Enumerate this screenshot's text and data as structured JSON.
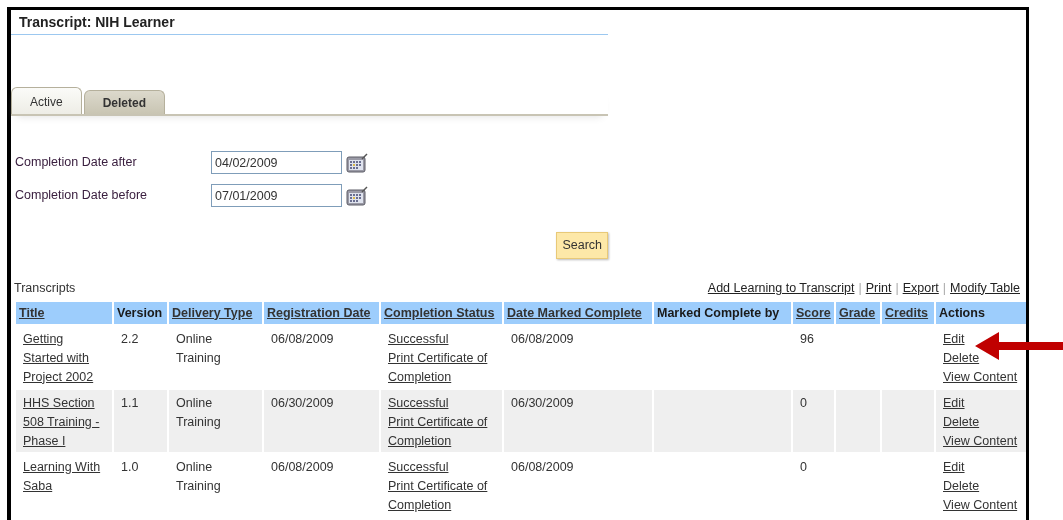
{
  "page": {
    "title": "Transcript: NIH Learner"
  },
  "tabs": [
    {
      "label": "Active",
      "selected": true
    },
    {
      "label": "Deleted",
      "selected": false
    }
  ],
  "filters": [
    {
      "label": "Completion Date after",
      "value": "04/02/2009"
    },
    {
      "label": "Completion Date before",
      "value": "07/01/2009"
    }
  ],
  "search_button": "Search",
  "transcripts": {
    "heading": "Transcripts",
    "toolbar": [
      {
        "kind": "link",
        "text": "Add Learning to Transcript"
      },
      {
        "kind": "separator",
        "text": "|"
      },
      {
        "kind": "link",
        "text": "Print"
      },
      {
        "kind": "separator",
        "text": "|"
      },
      {
        "kind": "link",
        "text": "Export"
      },
      {
        "kind": "separator",
        "text": "|"
      },
      {
        "kind": "link",
        "text": "Modify Table"
      }
    ],
    "columns": [
      {
        "label": "Title",
        "sortable": true
      },
      {
        "label": "Version",
        "sortable": false
      },
      {
        "label": "Delivery Type",
        "sortable": true
      },
      {
        "label": "Registration Date",
        "sortable": true
      },
      {
        "label": "Completion Status",
        "sortable": true
      },
      {
        "label": "Date Marked Complete",
        "sortable": true
      },
      {
        "label": "Marked Complete by",
        "sortable": false
      },
      {
        "label": "Score",
        "sortable": true
      },
      {
        "label": "Grade",
        "sortable": true
      },
      {
        "label": "Credits",
        "sortable": true
      },
      {
        "label": "Actions",
        "sortable": false
      }
    ],
    "rows": [
      {
        "title": "Getting Started with Project 2002",
        "version": "2.2",
        "delivery_type": "Online Training",
        "registration_date": "06/08/2009",
        "completion_status": "Successful",
        "certificate_link": "Print Certificate of Completion",
        "date_marked_complete": "06/08/2009",
        "score": "96",
        "actions": [
          "Edit",
          "Delete",
          "View Content"
        ]
      },
      {
        "title": "HHS Section 508 Training - Phase I",
        "version": "1.1",
        "delivery_type": "Online Training",
        "registration_date": "06/30/2009",
        "completion_status": "Successful",
        "certificate_link": "Print Certificate of Completion",
        "date_marked_complete": "06/30/2009",
        "score": "0",
        "actions": [
          "Edit",
          "Delete",
          "View Content"
        ]
      },
      {
        "title": "Learning With Saba",
        "version": "1.0",
        "delivery_type": "Online Training",
        "registration_date": "06/08/2009",
        "completion_status": "Successful",
        "certificate_link": "Print Certificate of Completion",
        "date_marked_complete": "06/08/2009",
        "score": "0",
        "actions": [
          "Edit",
          "Delete",
          "View Content"
        ]
      }
    ]
  }
}
